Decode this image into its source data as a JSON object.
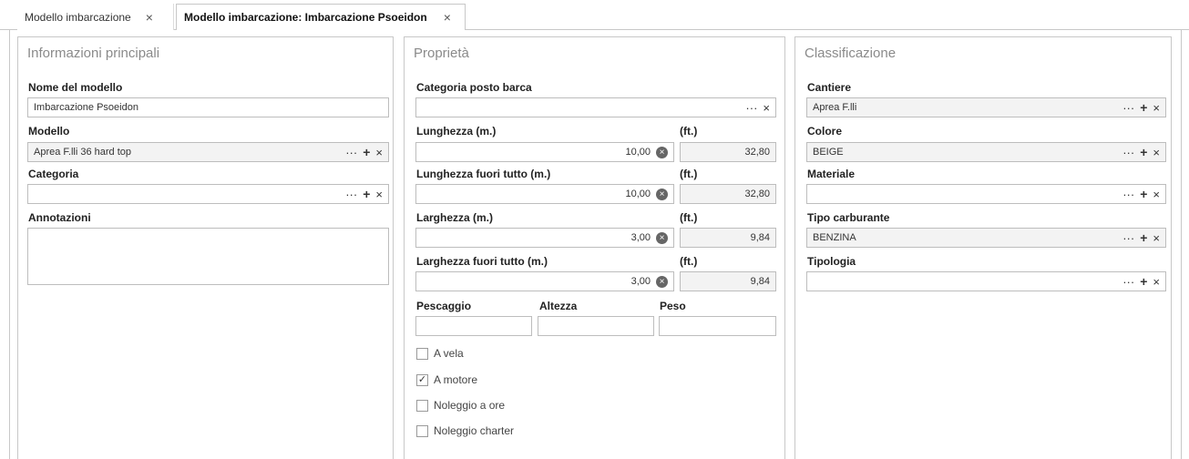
{
  "tabs": [
    {
      "label": "Modello imbarcazione",
      "close": "×"
    },
    {
      "label": "Modello imbarcazione: Imbarcazione Psoeidon",
      "close": "×"
    }
  ],
  "main_info": {
    "title": "Informazioni principali",
    "nome_label": "Nome del modello",
    "nome_value": "Imbarcazione Psoeidon",
    "modello_label": "Modello",
    "modello_value": "Aprea F.lli 36 hard top",
    "categoria_label": "Categoria",
    "categoria_value": "",
    "annotazioni_label": "Annotazioni",
    "annotazioni_value": ""
  },
  "properties": {
    "title": "Proprietà",
    "cat_posto_label": "Categoria posto barca",
    "cat_posto_value": "",
    "ft_label": "(ft.)",
    "lunghezza_label": "Lunghezza (m.)",
    "lunghezza_m": "10,00",
    "lunghezza_ft": "32,80",
    "lunghezza_ft_label": "Lunghezza fuori tutto (m.)",
    "lunghezza_ft_m": "10,00",
    "lunghezza_ft_ft": "32,80",
    "larghezza_label": "Larghezza (m.)",
    "larghezza_m": "3,00",
    "larghezza_ft": "9,84",
    "larghezza_ft_label": "Larghezza fuori tutto (m.)",
    "larghezza_ft_m": "3,00",
    "larghezza_ft_ft": "9,84",
    "pescaggio_label": "Pescaggio",
    "altezza_label": "Altezza",
    "peso_label": "Peso",
    "checkboxes": [
      {
        "label": "A vela",
        "checked": false
      },
      {
        "label": "A motore",
        "checked": true
      },
      {
        "label": "Noleggio a ore",
        "checked": false
      },
      {
        "label": "Noleggio charter",
        "checked": false
      }
    ]
  },
  "classification": {
    "title": "Classificazione",
    "cantiere_label": "Cantiere",
    "cantiere_value": "Aprea F.lli",
    "colore_label": "Colore",
    "colore_value": "BEIGE",
    "materiale_label": "Materiale",
    "materiale_value": "",
    "carburante_label": "Tipo carburante",
    "carburante_value": "BENZINA",
    "tipologia_label": "Tipologia",
    "tipologia_value": ""
  },
  "glyphs": {
    "ellipsis": "···",
    "plus": "+",
    "clear": "×",
    "check": "✓"
  }
}
